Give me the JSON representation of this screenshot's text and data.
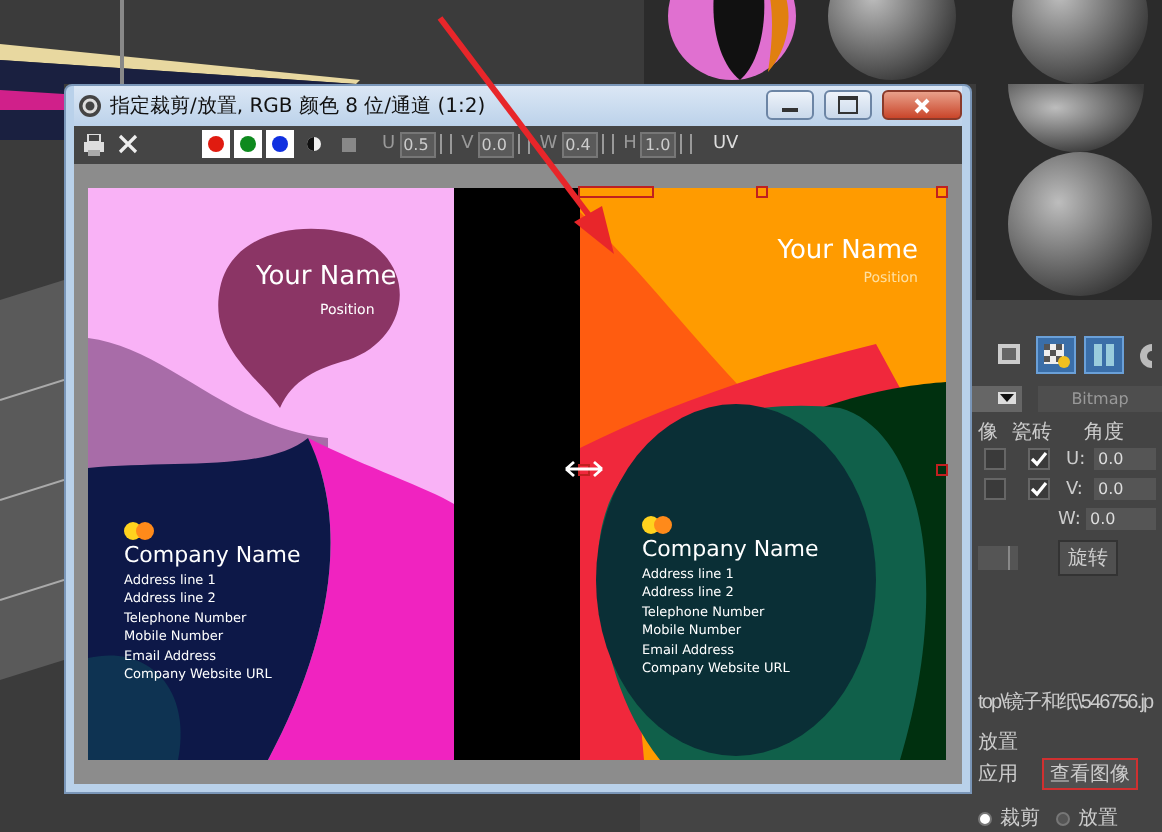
{
  "dialog": {
    "title": "指定裁剪/放置, RGB 颜色 8 位/通道 (1:2)",
    "channels": [
      {
        "color": "#e01b10",
        "on": true
      },
      {
        "color": "#0e8a1e",
        "on": true
      },
      {
        "color": "#1030e0",
        "on": true
      }
    ],
    "fields": [
      {
        "label": "U",
        "value": "0.5"
      },
      {
        "label": "V",
        "value": "0.0"
      },
      {
        "label": "W",
        "value": "0.4"
      },
      {
        "label": "H",
        "value": "1.0"
      }
    ],
    "mode_label": "UV",
    "cards": [
      {
        "kind": "pink",
        "name": "Your Name",
        "position": "Position",
        "company": "Company Name",
        "lines": [
          "Address line 1",
          "Address line 2",
          "Telephone Number",
          "Mobile Number",
          "Email Address",
          "Company Website URL"
        ]
      },
      {
        "kind": "orange",
        "name": "Your Name",
        "position": "Position",
        "company": "Company Name",
        "lines": [
          "Address line 1",
          "Address line 2",
          "Telephone Number",
          "Mobile Number",
          "Email Address",
          "Company Website URL"
        ]
      }
    ]
  },
  "panel": {
    "map_type": "Bitmap",
    "headers": [
      "像",
      "瓷砖",
      "角度"
    ],
    "rows": [
      {
        "mirror": false,
        "tile": true,
        "axis": "U:",
        "value": "0.0"
      },
      {
        "mirror": false,
        "tile": true,
        "axis": "V:",
        "value": "0.0"
      },
      {
        "axis": "W:",
        "value": "0.0"
      }
    ],
    "rotate_button": "旋转",
    "path": "top\\镜子和纸\\546756.jp",
    "group_label": "放置",
    "apply_label": "应用",
    "view_button": "查看图像",
    "modes": [
      {
        "label": "裁剪",
        "selected": true
      },
      {
        "label": "放置",
        "selected": false
      }
    ]
  }
}
